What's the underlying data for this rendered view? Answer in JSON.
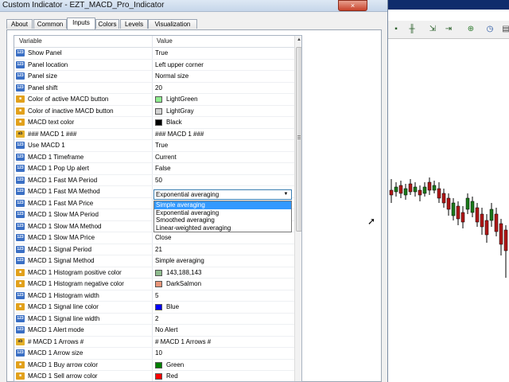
{
  "window": {
    "title": "Custom Indicator - EZT_MACD_Pro_Indicator",
    "close_glyph": "×"
  },
  "tabs": [
    "About",
    "Common",
    "Inputs",
    "Colors",
    "Levels",
    "Visualization"
  ],
  "active_tab": "Inputs",
  "grid": {
    "headers": {
      "variable": "Variable",
      "value": "Value"
    },
    "rows": [
      {
        "type": "num",
        "name": "Show Panel",
        "value": "True"
      },
      {
        "type": "num",
        "name": "Panel location",
        "value": "Left upper corner"
      },
      {
        "type": "num",
        "name": "Panel size",
        "value": "Normal size"
      },
      {
        "type": "num",
        "name": "Panel shift",
        "value": "20"
      },
      {
        "type": "col",
        "name": "Color of active MACD button",
        "value": "LightGreen",
        "color": "#90ee90"
      },
      {
        "type": "col",
        "name": "Color of inactive MACD button",
        "value": "LightGray",
        "color": "#d3d3d3"
      },
      {
        "type": "col",
        "name": "MACD text color",
        "value": "Black",
        "color": "#000000"
      },
      {
        "type": "ab",
        "name": "### MACD 1  ###",
        "value": "### MACD 1 ###"
      },
      {
        "type": "num",
        "name": "Use MACD 1",
        "value": "True"
      },
      {
        "type": "num",
        "name": "MACD 1 Timeframe",
        "value": "Current"
      },
      {
        "type": "num",
        "name": "MACD 1 Pop Up alert",
        "value": "False"
      },
      {
        "type": "num",
        "name": "MACD 1 Fast MA Period",
        "value": "50"
      },
      {
        "type": "num",
        "name": "MACD 1 Fast MA Method",
        "value": ""
      },
      {
        "type": "num",
        "name": "MACD 1 Fast MA Price",
        "value": ""
      },
      {
        "type": "num",
        "name": "MACD 1 Slow MA Period",
        "value": ""
      },
      {
        "type": "num",
        "name": "MACD 1 Slow MA Method",
        "value": ""
      },
      {
        "type": "num",
        "name": "MACD 1 Slow MA Price",
        "value": "Close"
      },
      {
        "type": "num",
        "name": "MACD 1 Signal Period",
        "value": "21"
      },
      {
        "type": "num",
        "name": "MACD 1 Signal Method",
        "value": "Simple averaging"
      },
      {
        "type": "col",
        "name": "MACD 1 Histogram positive color",
        "value": "143,188,143",
        "color": "#8fbc8f"
      },
      {
        "type": "col",
        "name": "MACD 1 Histogram negative color",
        "value": "DarkSalmon",
        "color": "#e9967a"
      },
      {
        "type": "num",
        "name": "MACD 1 Histogram width",
        "value": "5"
      },
      {
        "type": "col",
        "name": "MACD 1 Signal line color",
        "value": "Blue",
        "color": "#0000ff"
      },
      {
        "type": "num",
        "name": "MACD 1 Signal line width",
        "value": "2"
      },
      {
        "type": "num",
        "name": "MACD 1 Alert mode",
        "value": "No Alert"
      },
      {
        "type": "ab",
        "name": "# MACD 1 Arrows #",
        "value": "# MACD 1 Arrows #"
      },
      {
        "type": "num",
        "name": "MACD 1 Arrow size",
        "value": "10"
      },
      {
        "type": "col",
        "name": "MACD 1 Buy arrow color",
        "value": "Green",
        "color": "#008000"
      },
      {
        "type": "col",
        "name": "MACD 1 Sell arrow color",
        "value": "Red",
        "color": "#ff0000"
      }
    ]
  },
  "combo": {
    "value": "Exponential averaging"
  },
  "dropdown": {
    "options": [
      "Simple averaging",
      "Exponential averaging",
      "Smoothed averaging",
      "Linear-weighted averaging"
    ],
    "highlighted": "Simple averaging"
  },
  "icons": {
    "num": "123",
    "col": "■",
    "ab": "ab"
  },
  "colors": {
    "title_bar": "#c6d6ea",
    "chart_top": "#0f2c6c",
    "bull": "#1a7a1a",
    "bear": "#b01717"
  }
}
